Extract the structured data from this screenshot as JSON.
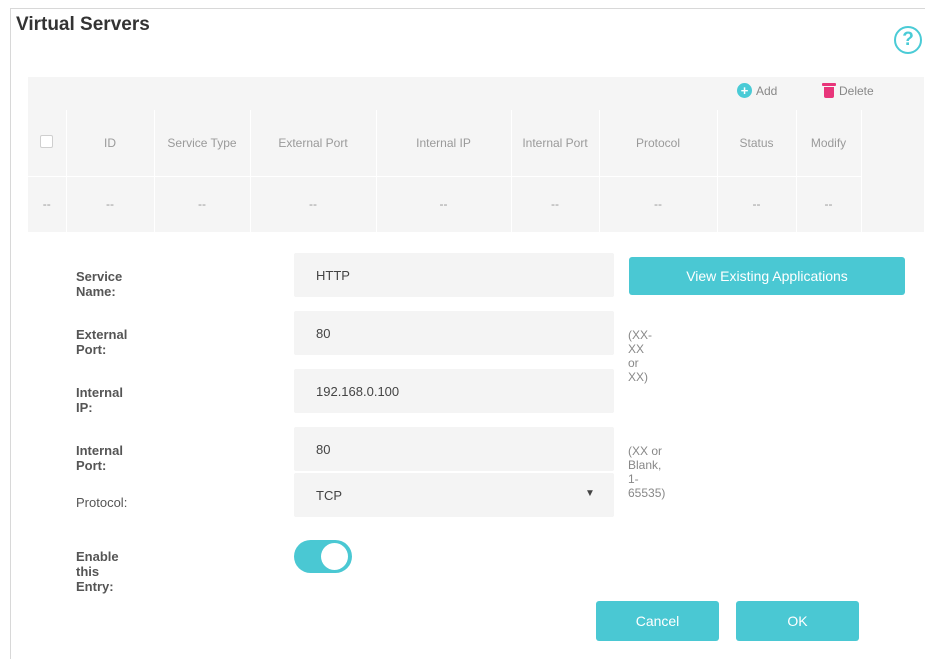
{
  "page": {
    "title": "Virtual Servers",
    "help_glyph": "?"
  },
  "toolbar": {
    "add_label": "Add",
    "delete_label": "Delete"
  },
  "table": {
    "headers": [
      "",
      "ID",
      "Service Type",
      "External Port",
      "Internal IP",
      "Internal Port",
      "Protocol",
      "Status",
      "Modify"
    ],
    "rows": [
      [
        "--",
        "--",
        "--",
        "--",
        "--",
        "--",
        "--",
        "--",
        "--"
      ]
    ]
  },
  "form": {
    "service_name": {
      "label": "Service Name:",
      "value": "HTTP"
    },
    "view_button": "View Existing Applications",
    "external_port": {
      "label": "External Port:",
      "value": "80",
      "hint": "(XX-XX or XX)"
    },
    "internal_ip": {
      "label": "Internal IP:",
      "value": "192.168.0.100"
    },
    "internal_port": {
      "label": "Internal Port:",
      "value": "80",
      "hint": "(XX or Blank, 1-65535)"
    },
    "protocol": {
      "label": "Protocol:",
      "value": "TCP"
    },
    "enable_entry": {
      "label": "Enable this Entry:",
      "enabled": true
    }
  },
  "actions": {
    "cancel": "Cancel",
    "ok": "OK"
  },
  "colors": {
    "accent": "#4ac8d3",
    "delete": "#e8357a",
    "table_bg": "#f5f5f5"
  }
}
